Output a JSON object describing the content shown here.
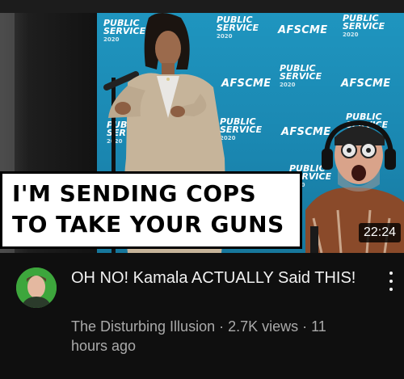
{
  "video": {
    "thumbnail": {
      "backdrop_logos": {
        "public_service_line1": "PUBLIC",
        "public_service_line2": "SERVICE",
        "public_service_year": "2020",
        "afscme": "AFSCME"
      },
      "caption_line1": "I'M SENDING COPS",
      "caption_line2": "TO TAKE YOUR GUNS",
      "duration": "22:24"
    },
    "title": "OH NO!  Kamala ACTUALLY Said THIS!",
    "meta": "The Disturbing Illusion · 2.7K views · 11 hours ago",
    "icons": {
      "menu": "more-vert-icon"
    }
  },
  "colors": {
    "background": "#0f0f0f",
    "title_text": "#f1f1f1",
    "meta_text": "#aaaaaa",
    "backdrop_blue": "#1a86b0"
  }
}
